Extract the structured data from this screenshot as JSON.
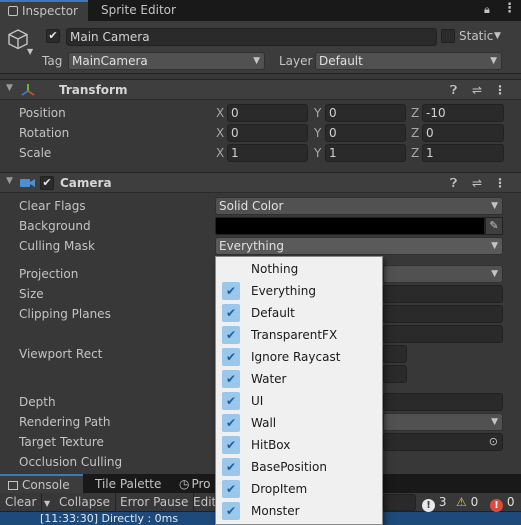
{
  "tabs": {
    "inspector": "Inspector",
    "sprite_editor": "Sprite Editor"
  },
  "object": {
    "name": "Main Camera",
    "static_label": "Static",
    "tag_label": "Tag",
    "tag_value": "MainCamera",
    "layer_label": "Layer",
    "layer_value": "Default"
  },
  "transform": {
    "title": "Transform",
    "position_label": "Position",
    "rotation_label": "Rotation",
    "scale_label": "Scale",
    "x": "X",
    "y": "Y",
    "z": "Z",
    "position": [
      "0",
      "0",
      "-10"
    ],
    "rotation": [
      "0",
      "0",
      "0"
    ],
    "scale": [
      "1",
      "1",
      "1"
    ]
  },
  "camera": {
    "title": "Camera",
    "clear_flags_label": "Clear Flags",
    "clear_flags_value": "Solid Color",
    "background_label": "Background",
    "culling_mask_label": "Culling Mask",
    "culling_mask_value": "Everything",
    "projection_label": "Projection",
    "size_label": "Size",
    "clipping_planes_label": "Clipping Planes",
    "viewport_rect_label": "Viewport Rect",
    "depth_label": "Depth",
    "rendering_path_label": "Rendering Path",
    "target_texture_label": "Target Texture",
    "occlusion_culling_label": "Occlusion Culling"
  },
  "culling_menu": {
    "items": [
      {
        "label": "Nothing",
        "checked": false
      },
      {
        "label": "Everything",
        "checked": true
      },
      {
        "label": "Default",
        "checked": true
      },
      {
        "label": "TransparentFX",
        "checked": true
      },
      {
        "label": "Ignore Raycast",
        "checked": true
      },
      {
        "label": "Water",
        "checked": true
      },
      {
        "label": "UI",
        "checked": true
      },
      {
        "label": "Wall",
        "checked": true
      },
      {
        "label": "HitBox",
        "checked": true
      },
      {
        "label": "BasePosition",
        "checked": true
      },
      {
        "label": "DropItem",
        "checked": true
      },
      {
        "label": "Monster",
        "checked": true
      }
    ]
  },
  "bottom_tabs": {
    "console": "Console",
    "tile_palette": "Tile Palette",
    "third": "Pro"
  },
  "console_toolbar": {
    "clear": "Clear",
    "collapse": "Collapse",
    "error_pause": "Error Pause",
    "editor": "Edit",
    "info_count": "3",
    "warn_count": "0",
    "error_count": "0"
  },
  "log_line": "[11:33:30] Directly : 0ms",
  "colors": {
    "accent": "#3a79bb",
    "menu_check_bg": "#9bc7ea",
    "panel_bg": "#383838"
  }
}
